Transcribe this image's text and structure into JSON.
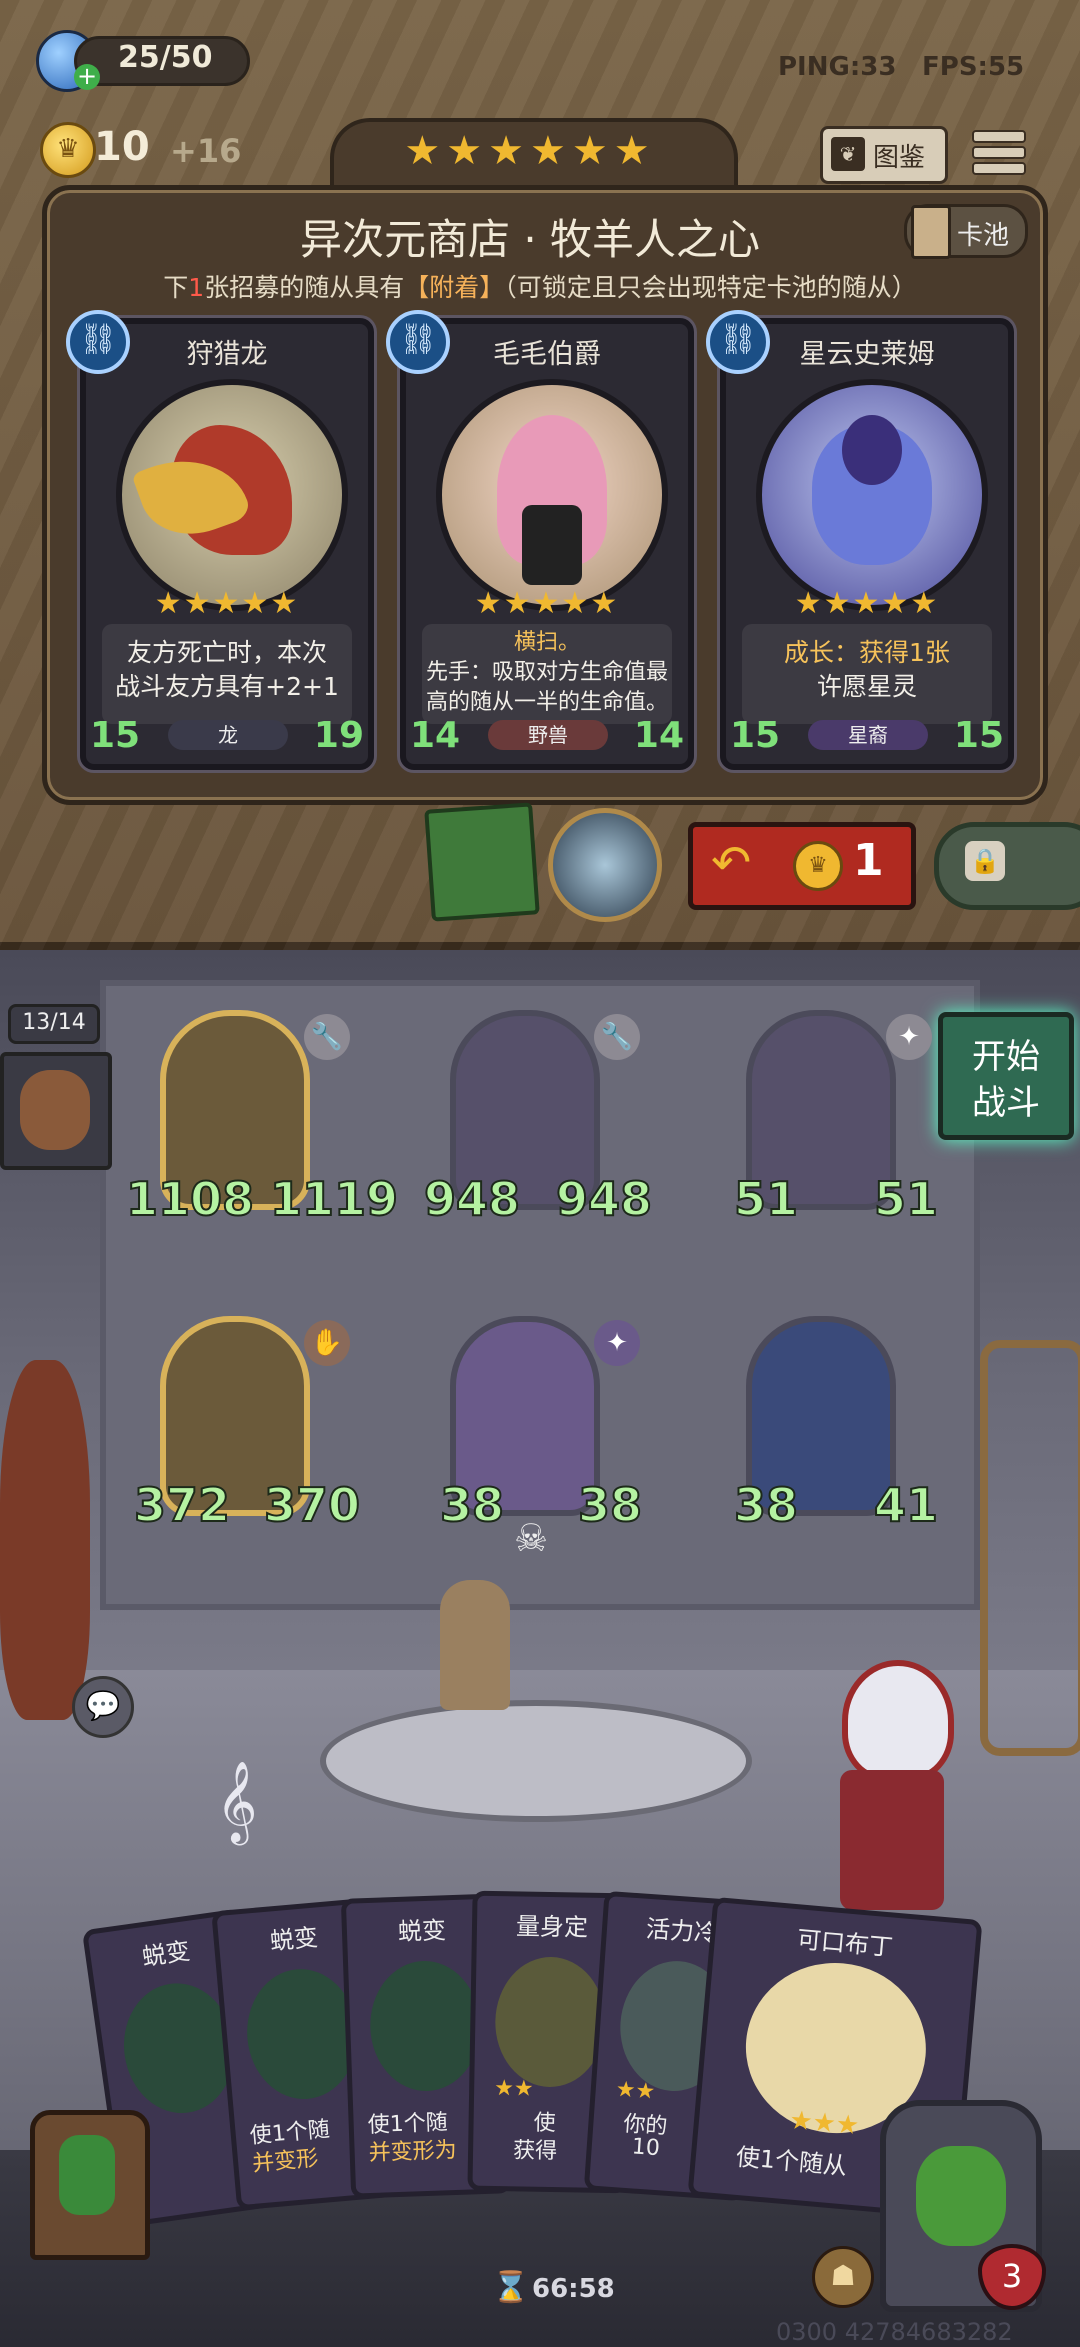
{
  "top_bar": {
    "energy": "25/50",
    "ping": "PING:33",
    "fps": "FPS:55",
    "gold": "10",
    "gold_income": "+16",
    "tier_stars": "★★★★★★",
    "codex_label": "图鉴",
    "menu_icon": "hamburger-icon"
  },
  "shop": {
    "title": "异次元商店 · 牧羊人之心",
    "card_pool_label": "卡池",
    "subtitle_prefix": "下",
    "subtitle_num": "1",
    "subtitle_mid": "张招募的随从具有",
    "subtitle_keyword": "【附着】",
    "subtitle_suffix": "（可锁定且只会出现特定卡池的随从）",
    "cards": [
      {
        "name": "狩猎龙",
        "stars": "★★★★★",
        "desc_line1": "友方死亡时，本次",
        "desc_line2": "战斗友方具有+2+1",
        "attack": "15",
        "health": "19",
        "tribe": "龙",
        "tribe_color": "#3a3a4a"
      },
      {
        "name": "毛毛伯爵",
        "stars": "★★★★★",
        "desc_line1": "横扫。",
        "desc_line2": "先手：吸取对方生命值最",
        "desc_line3": "高的随从一半的生命值。",
        "attack": "14",
        "health": "14",
        "tribe": "野兽",
        "tribe_color": "#6a3a3a"
      },
      {
        "name": "星云史莱姆",
        "stars": "★★★★★",
        "desc_line1": "成长：获得1张",
        "desc_line2": "许愿星灵",
        "attack": "15",
        "health": "15",
        "tribe": "星裔",
        "tribe_color": "#4a3a6a"
      }
    ],
    "refresh_cost": "1"
  },
  "board": {
    "hand_count": "13/14",
    "start_battle_line1": "开始",
    "start_battle_line2": "战斗",
    "units": [
      {
        "attack": "1108",
        "health": "1119",
        "golden": true
      },
      {
        "attack": "948",
        "health": "948",
        "golden": false
      },
      {
        "attack": "51",
        "health": "51",
        "golden": false
      },
      {
        "attack": "372",
        "health": "370",
        "golden": true
      },
      {
        "attack": "38",
        "health": "38",
        "golden": false
      },
      {
        "attack": "38",
        "health": "41",
        "golden": false
      }
    ]
  },
  "hand": {
    "cards": [
      {
        "title": "蜕变",
        "text": ""
      },
      {
        "title": "蜕变",
        "text": "使1个随"
      },
      {
        "title": "蜕变",
        "text": "使1个随"
      },
      {
        "title": "量身定",
        "text": "使"
      },
      {
        "title": "活力冷",
        "text": "你的"
      },
      {
        "title": "可口布丁",
        "text": "使1个随从"
      }
    ],
    "card2_line2": "并变形",
    "card3_line2": "并变形为",
    "card4_line2": "获得",
    "card5_line2": "10"
  },
  "footer": {
    "timer": "66:58",
    "hero_health": "3",
    "id_text": "0300 42784683282"
  }
}
